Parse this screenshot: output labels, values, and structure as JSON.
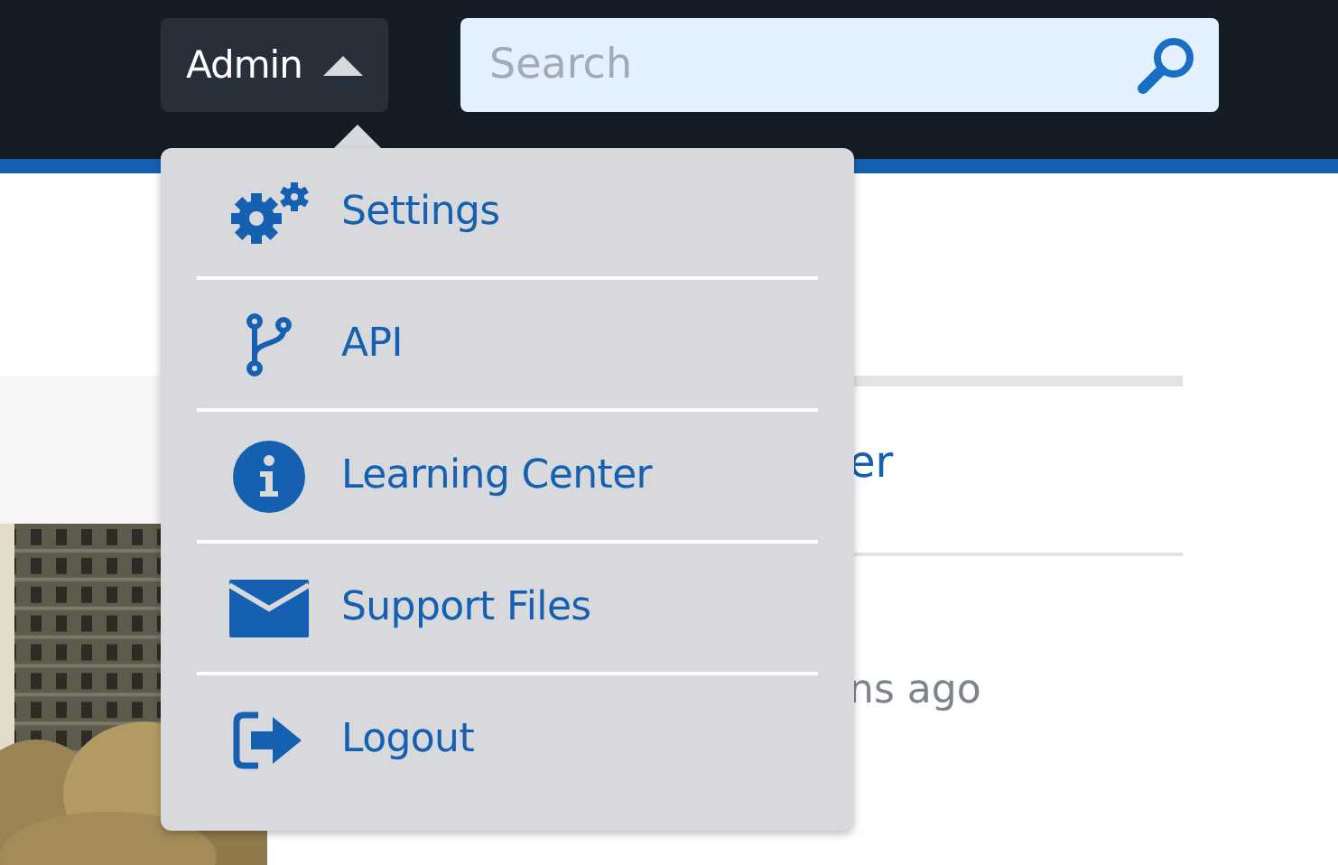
{
  "topbar": {
    "account_button": {
      "label": "Admin",
      "expanded": true
    },
    "search": {
      "placeholder": "Search"
    }
  },
  "account_menu": {
    "items": [
      {
        "label": "Settings"
      },
      {
        "label": "API"
      },
      {
        "label": "Learning Center"
      },
      {
        "label": "Support Files"
      },
      {
        "label": "Logout"
      }
    ]
  },
  "content": {
    "link": "er",
    "time": "ns ago"
  }
}
